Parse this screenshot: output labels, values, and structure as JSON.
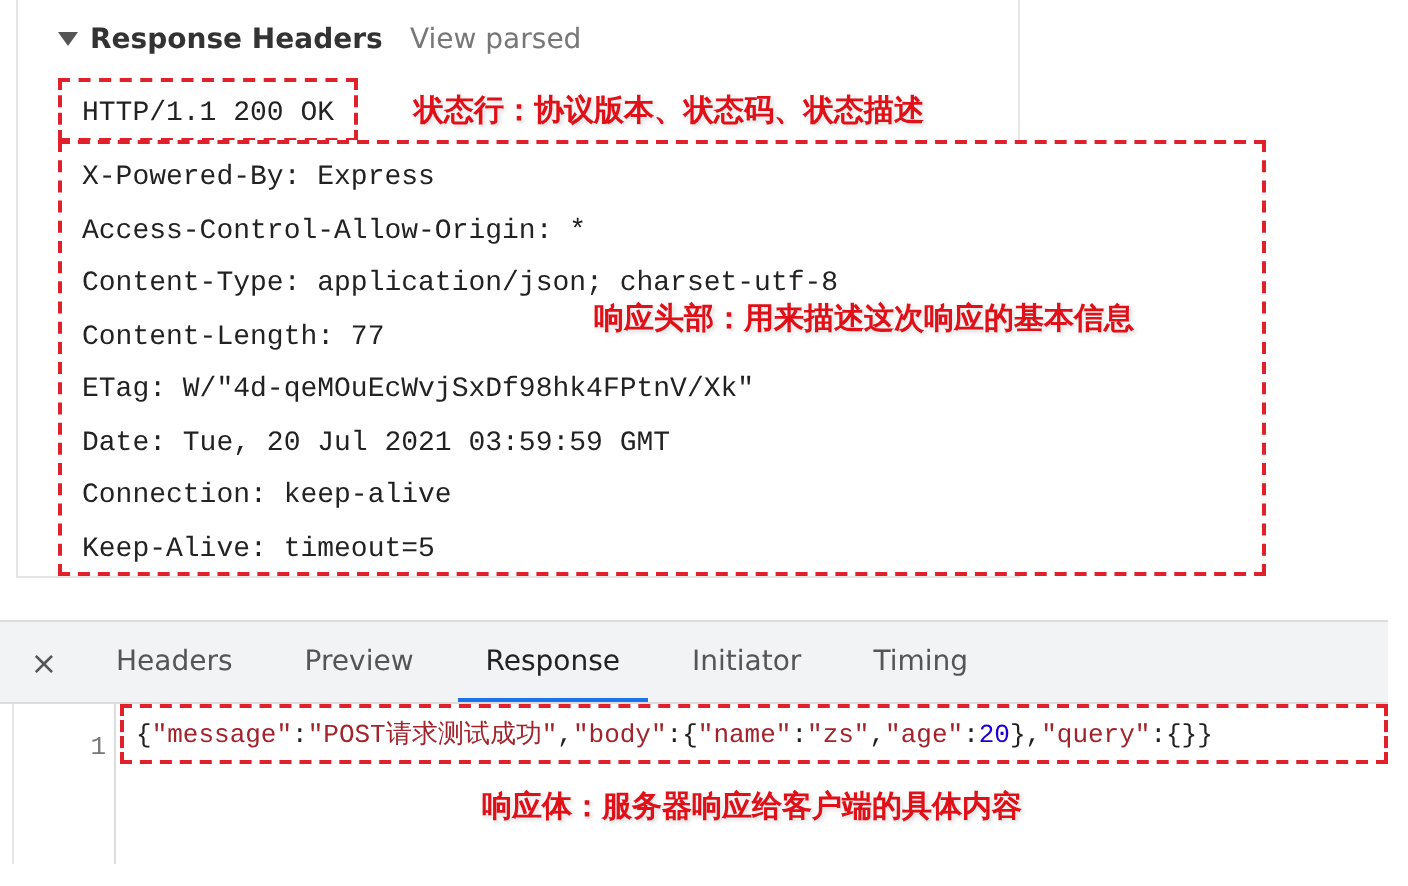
{
  "response_headers": {
    "title": "Response Headers",
    "expanded": true,
    "view_parsed": "View parsed",
    "status_line": "HTTP/1.1 200 OK",
    "status_note": "状态行：协议版本、状态码、状态描述",
    "headers": [
      "X-Powered-By: Express",
      "Access-Control-Allow-Origin: *",
      "Content-Type: application/json; charset-utf-8",
      "Content-Length: 77",
      "ETag: W/\"4d-qeMOuEcWvjSxDf98hk4FPtnV/Xk\"",
      "Date: Tue, 20 Jul 2021 03:59:59 GMT",
      "Connection: keep-alive",
      "Keep-Alive: timeout=5"
    ],
    "headers_note": "响应头部：用来描述这次响应的基本信息"
  },
  "panel": {
    "close": "×",
    "tabs": [
      {
        "label": "Headers",
        "selected": false
      },
      {
        "label": "Preview",
        "selected": false
      },
      {
        "label": "Response",
        "selected": true
      },
      {
        "label": "Initiator",
        "selected": false
      },
      {
        "label": "Timing",
        "selected": false
      }
    ],
    "line_number": "1",
    "tokens": [
      {
        "text": "{",
        "kind": "punct"
      },
      {
        "text": "\"message\"",
        "kind": "key"
      },
      {
        "text": ":",
        "kind": "punct"
      },
      {
        "text": "\"POST请求测试成功\"",
        "kind": "string"
      },
      {
        "text": ",",
        "kind": "punct"
      },
      {
        "text": "\"body\"",
        "kind": "key"
      },
      {
        "text": ":{",
        "kind": "punct"
      },
      {
        "text": "\"name\"",
        "kind": "key"
      },
      {
        "text": ":",
        "kind": "punct"
      },
      {
        "text": "\"zs\"",
        "kind": "string"
      },
      {
        "text": ",",
        "kind": "punct"
      },
      {
        "text": "\"age\"",
        "kind": "key"
      },
      {
        "text": ":",
        "kind": "punct"
      },
      {
        "text": "20",
        "kind": "number"
      },
      {
        "text": "},",
        "kind": "punct"
      },
      {
        "text": "\"query\"",
        "kind": "key"
      },
      {
        "text": ":{}}",
        "kind": "punct"
      }
    ],
    "body_note": "响应体：服务器响应给客户端的具体内容"
  }
}
